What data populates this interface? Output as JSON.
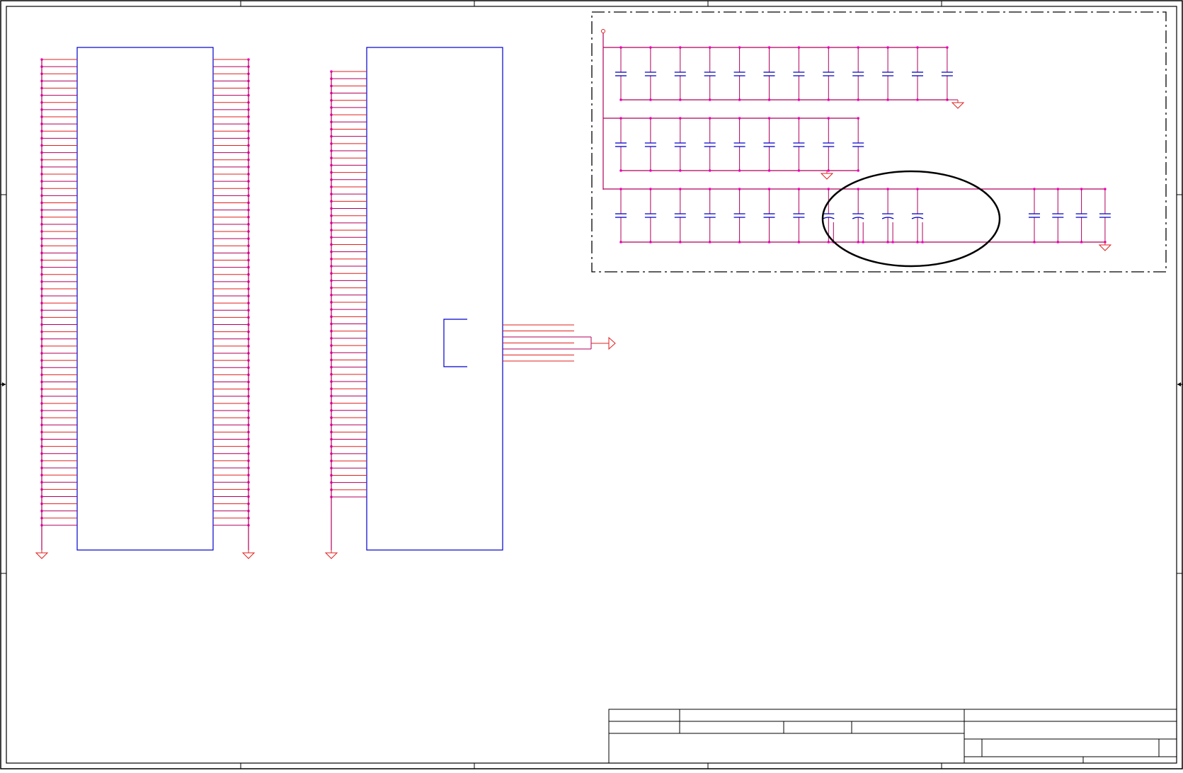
{
  "sheet": {
    "title_block": {
      "title": "",
      "size": "",
      "document_number": "",
      "revision": "",
      "date": "",
      "sheet_number": ""
    }
  },
  "colors": {
    "wire": "#b0005a",
    "pin": "#e02020",
    "junction": "#ff00cc",
    "part_body": "#0000cc",
    "highlight_outline": "#000000",
    "border": "#000000"
  },
  "components": {
    "left_connector": {
      "pin_rows": 66
    },
    "right_connector": {
      "pin_rows": 60
    },
    "bypass_capacitor_bank": {
      "row_1_capacitors": 12,
      "row_2_capacitors": 9,
      "row_3_capacitors": 15,
      "highlighted_capacitors": 4
    },
    "connector_side_signals": 7
  }
}
